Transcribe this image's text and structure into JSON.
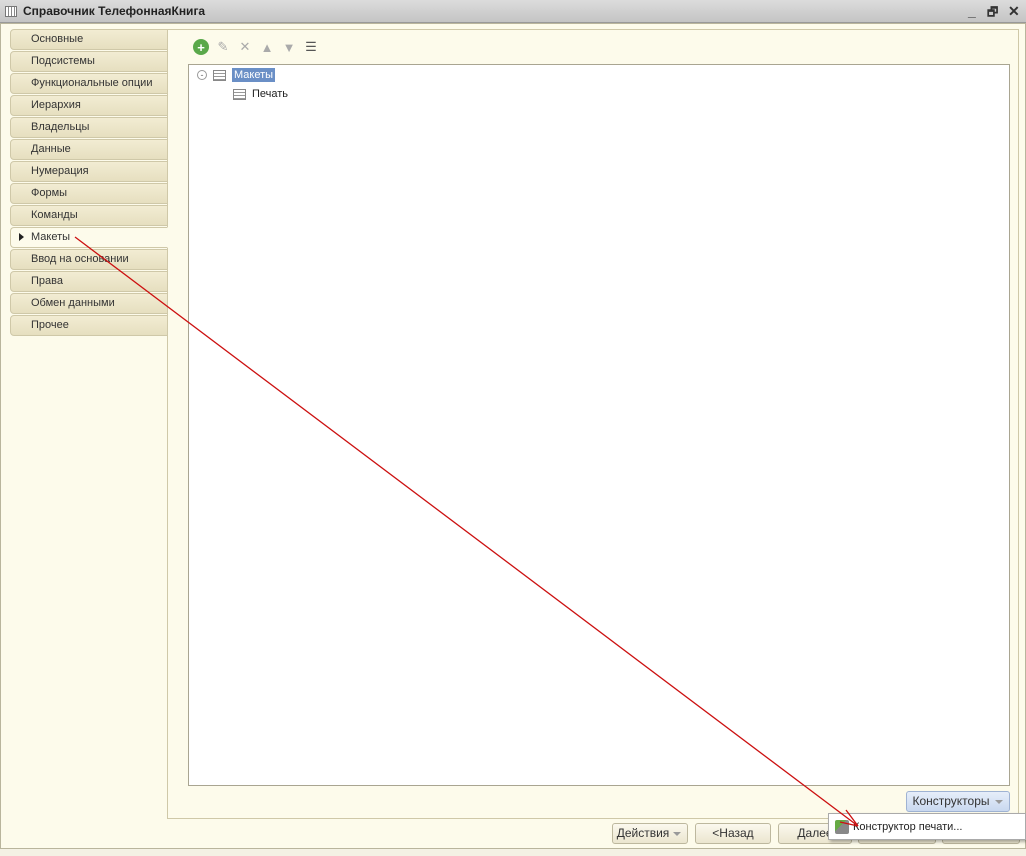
{
  "window": {
    "title": "Справочник ТелефоннаяКнига",
    "minimize": "_",
    "restore": "🗗",
    "close": "✕"
  },
  "tabs": [
    "Основные",
    "Подсистемы",
    "Функциональные опции",
    "Иерархия",
    "Владельцы",
    "Данные",
    "Нумерация",
    "Формы",
    "Команды",
    "Макеты",
    "Ввод на основании",
    "Права",
    "Обмен данными",
    "Прочее"
  ],
  "selected_tab": "Макеты",
  "toolbar": {
    "add": "+",
    "edit": "✎",
    "delete": "✕",
    "up": "▲",
    "down": "▼",
    "list": "☰"
  },
  "tree": {
    "root": "Макеты",
    "children": [
      "Печать"
    ]
  },
  "constructors_label": "Конструкторы",
  "buttons": {
    "actions": "Действия",
    "back": "<Назад",
    "next": "Далее"
  },
  "popup_item": "Конструктор печати...",
  "colors": {
    "selection": "#6a8fc6",
    "arrow": "#cc1010"
  }
}
